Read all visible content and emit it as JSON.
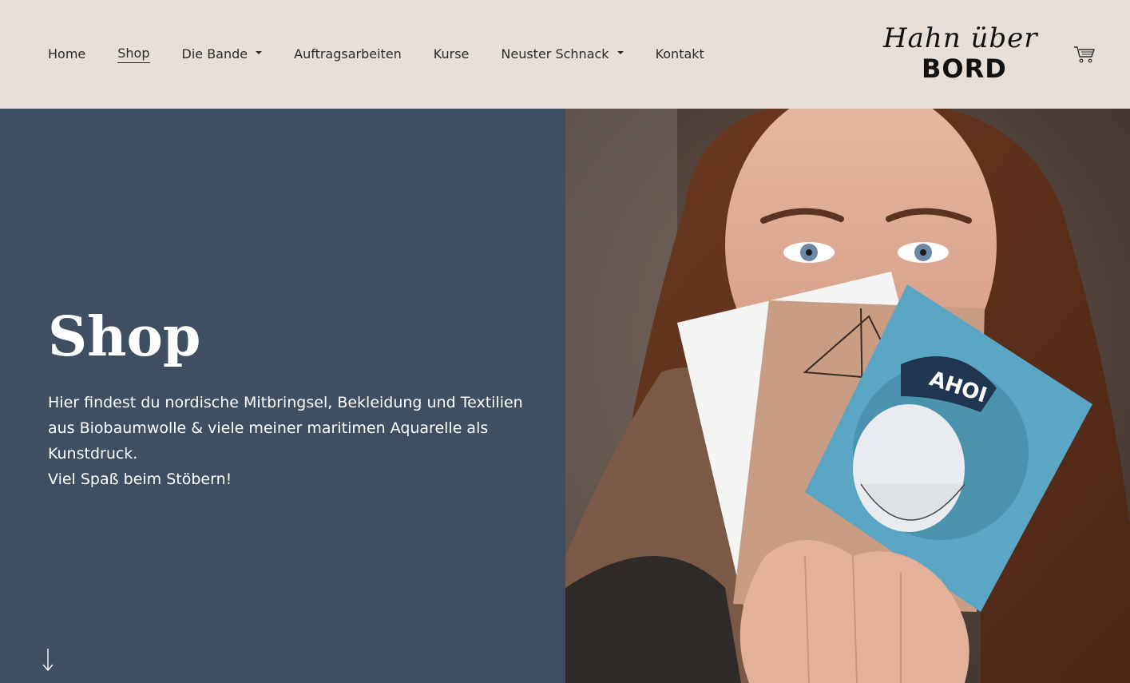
{
  "nav": {
    "items": [
      {
        "label": "Home",
        "active": false,
        "dropdown": false
      },
      {
        "label": "Shop",
        "active": true,
        "dropdown": false
      },
      {
        "label": "Die Bande",
        "active": false,
        "dropdown": true
      },
      {
        "label": "Auftragsarbeiten",
        "active": false,
        "dropdown": false
      },
      {
        "label": "Kurse",
        "active": false,
        "dropdown": false
      },
      {
        "label": "Neuster Schnack",
        "active": false,
        "dropdown": true
      },
      {
        "label": "Kontakt",
        "active": false,
        "dropdown": false
      }
    ]
  },
  "logo": {
    "line1": "Hahn über",
    "line2": "BORD"
  },
  "icons": {
    "cart": "shopping-cart-icon",
    "scroll": "arrow-down-icon",
    "dropdown": "caret-down-icon"
  },
  "hero": {
    "title": "Shop",
    "text_lines": [
      "Hier findest du nordische Mitbringsel, Bekleidung und Textilien aus Biobaumwolle & viele meiner maritimen Aquarelle als Kunstdruck.",
      "Viel Spaß beim Stöbern!"
    ],
    "card_text": "AHOI"
  },
  "colors": {
    "header_bg": "#e8e0d8",
    "hero_left_bg": "#404e61",
    "text_dark": "#2b2b2b",
    "text_light": "#ffffff"
  }
}
